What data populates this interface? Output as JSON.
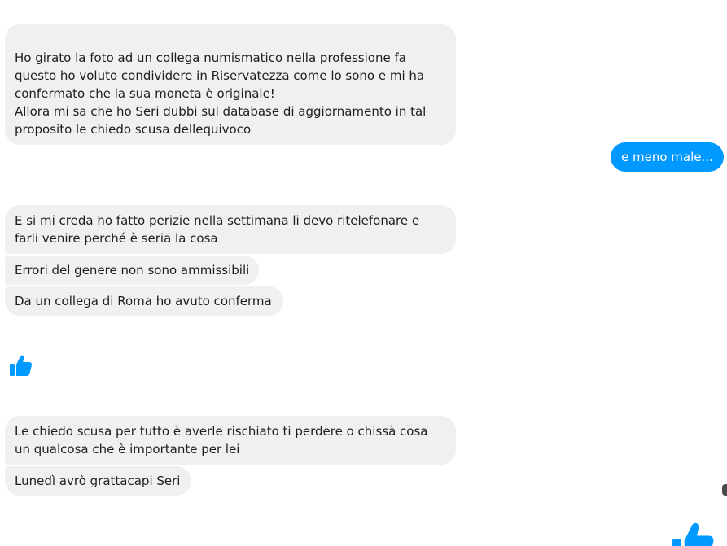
{
  "colors": {
    "incoming_bg": "#f0f0f0",
    "outgoing_bg": "#0099ff",
    "like_blue": "#0099ff"
  },
  "messages": [
    {
      "id": "m1",
      "direction": "incoming",
      "text": "Ho girato la foto ad un collega numismatico nella professione fa questo ho voluto condividere in Riservatezza come lo sono e mi ha confermato che la sua moneta è originale!\nAllora mi sa che ho Seri dubbi sul database di aggiornamento in tal proposito le chiedo scusa dellequivoco"
    },
    {
      "id": "m2",
      "direction": "outgoing",
      "text": "e meno male..."
    },
    {
      "id": "m3",
      "direction": "incoming",
      "text": "E si mi creda ho fatto perizie nella settimana li devo ritelefonare e farli venire perché è seria la cosa"
    },
    {
      "id": "m4",
      "direction": "incoming",
      "text": "Errori del genere non sono ammissibili"
    },
    {
      "id": "m5",
      "direction": "incoming",
      "text": "Da un collega di Roma ho avuto conferma"
    },
    {
      "id": "m6",
      "direction": "incoming",
      "icon": "thumbs-up-icon"
    },
    {
      "id": "m7",
      "direction": "incoming",
      "text": "Le chiedo scusa per tutto è averle rischiato ti perdere o chissà cosa un qualcosa che è importante per lei"
    },
    {
      "id": "m8",
      "direction": "incoming",
      "text": "Lunedì avrò grattacapi Seri"
    },
    {
      "id": "m9",
      "direction": "outgoing",
      "icon": "thumbs-up-icon"
    }
  ]
}
